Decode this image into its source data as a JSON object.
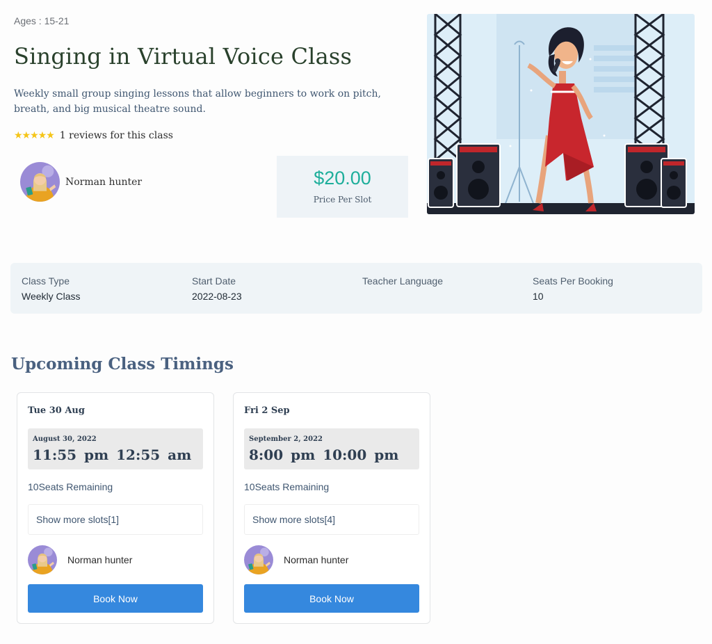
{
  "class": {
    "ages": "Ages : 15-21",
    "title": "Singing in Virtual Voice Class",
    "description": "Weekly small group singing lessons that allow beginners to work on pitch, breath, and big musical theatre sound.",
    "rating": {
      "stars": 5,
      "star_glyphs": "★★★★★",
      "reviews_text": "1 reviews for this class"
    },
    "teacher_name": "Norman hunter",
    "price": "$20.00",
    "price_label": "Price Per Slot"
  },
  "info": [
    {
      "label": "Class Type",
      "value": "Weekly Class"
    },
    {
      "label": "Start Date",
      "value": "2022-08-23"
    },
    {
      "label": "Teacher Language",
      "value": ""
    },
    {
      "label": "Seats Per Booking",
      "value": "10"
    }
  ],
  "timings": {
    "title": "Upcoming Class Timings",
    "cards": [
      {
        "day": "Tue 30 Aug",
        "date": "August 30, 2022",
        "start": "11:55 pm",
        "end": "12:55 am",
        "seats": "10Seats Remaining",
        "slots_label": "Show more slots[1]",
        "teacher": "Norman hunter",
        "book_label": "Book Now"
      },
      {
        "day": "Fri 2 Sep",
        "date": "September 2, 2022",
        "start": "8:00 pm",
        "end": "10:00 pm",
        "seats": "10Seats Remaining",
        "slots_label": "Show more slots[4]",
        "teacher": "Norman hunter",
        "book_label": "Book Now"
      }
    ]
  },
  "colors": {
    "accent_blue": "#3588de",
    "price_teal": "#1eae9b",
    "title_green": "#29412c",
    "section_title": "#4a6180",
    "info_bg": "#eff4f7",
    "star": "#f5c518"
  }
}
